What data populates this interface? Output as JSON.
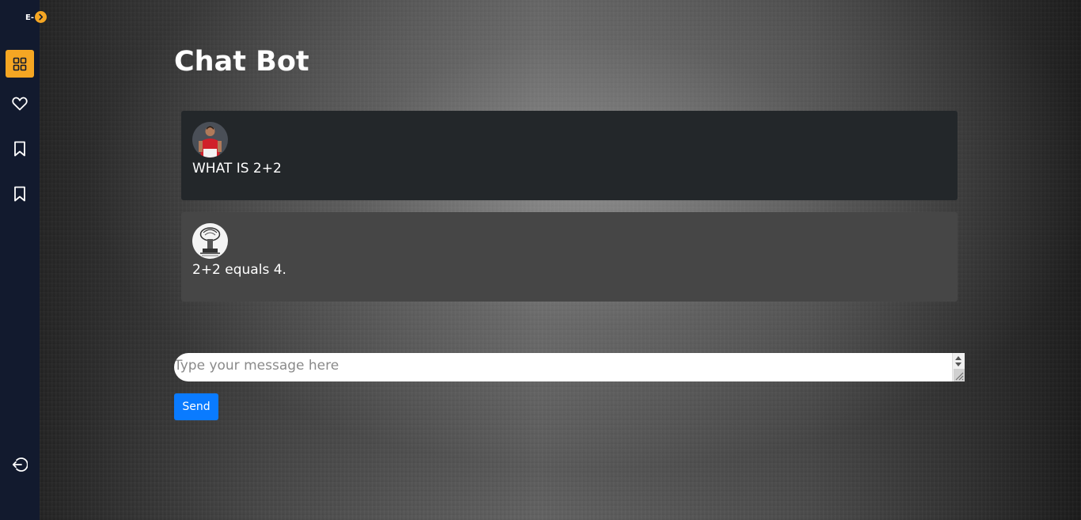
{
  "sidebar": {
    "brand": "E-",
    "accent_color": "#f5a623",
    "items": [
      {
        "name": "dashboard",
        "icon": "grid-icon",
        "active": true
      },
      {
        "name": "favorites",
        "icon": "heart-icon",
        "active": false
      },
      {
        "name": "bookmarks",
        "icon": "bookmark-icon",
        "active": false
      },
      {
        "name": "saved",
        "icon": "bookmark-icon",
        "active": false
      }
    ],
    "logout_icon": "logout-icon"
  },
  "page": {
    "title": "Chat Bot"
  },
  "messages": [
    {
      "sender": "user",
      "avatar": "user-avatar",
      "text": "WHAT IS 2+2"
    },
    {
      "sender": "bot",
      "avatar": "bot-avatar",
      "text": "2+2 equals 4."
    }
  ],
  "composer": {
    "placeholder": "Type your message here",
    "value": "",
    "send_label": "Send",
    "send_color": "#0a7bff"
  }
}
